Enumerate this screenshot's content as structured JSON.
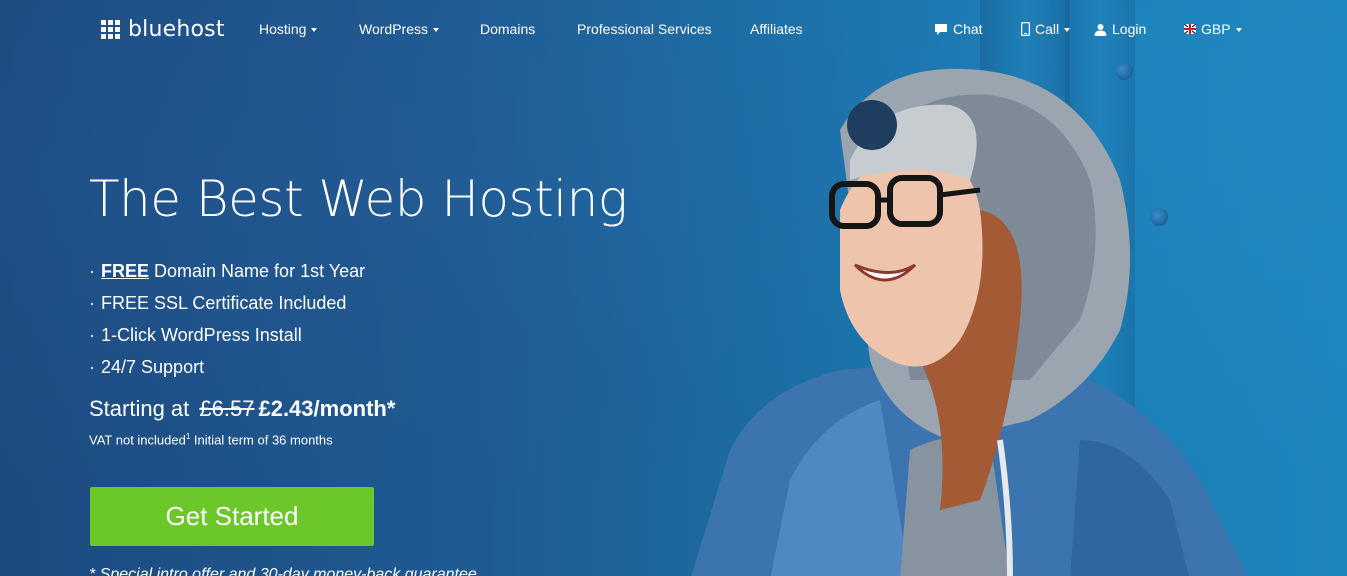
{
  "brand": {
    "name": "bluehost"
  },
  "nav": {
    "hosting": "Hosting",
    "wordpress": "WordPress",
    "domains": "Domains",
    "professional_services": "Professional Services",
    "affiliates": "Affiliates",
    "chat": "Chat",
    "call": "Call",
    "login": "Login",
    "currency": "GBP"
  },
  "hero": {
    "headline": "The Best Web Hosting",
    "bullets": [
      {
        "prefix": "FREE",
        "text": " Domain Name for 1st Year"
      },
      {
        "text": "FREE SSL Certificate Included"
      },
      {
        "text": "1-Click WordPress Install"
      },
      {
        "text": "24/7 Support"
      }
    ],
    "price_prefix": "Starting at",
    "old_price": "£6.57",
    "new_price": "£2.43/month*",
    "vat_note": "VAT not included",
    "vat_sup": "1",
    "term_note": "Initial term of 36 months",
    "cta_label": "Get Started",
    "guarantee": "* Special intro offer and 30-day money-back guarantee"
  },
  "colors": {
    "cta": "#6cc72b",
    "background": "#1d4f86"
  },
  "icons": {
    "chat": "chat-bubble-icon",
    "call": "phone-icon",
    "login": "user-icon",
    "currency": "uk-flag-icon"
  }
}
